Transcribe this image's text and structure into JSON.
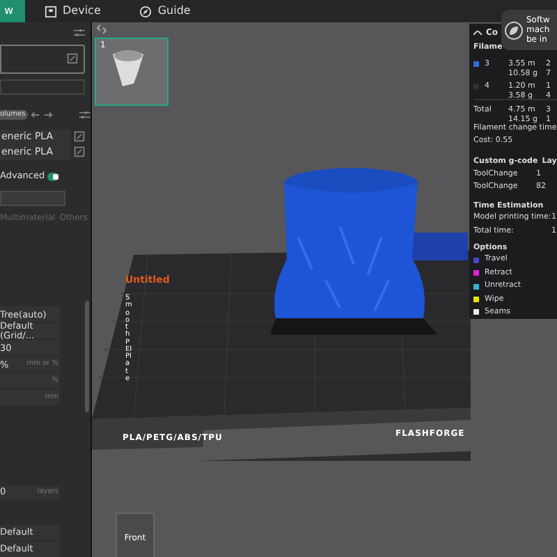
{
  "topbar": {
    "tabs": [
      {
        "label": "w",
        "selected": true
      },
      {
        "label": "Device",
        "selected": false
      },
      {
        "label": "Guide",
        "selected": false
      }
    ]
  },
  "left_panel": {
    "volumes_badge": "olumes",
    "filaments": [
      "eneric PLA",
      "eneric PLA"
    ],
    "advanced": {
      "label": "Advanced",
      "on": true
    },
    "tabs": [
      {
        "label": "Multimaterial",
        "selected": false
      },
      {
        "label": "Others",
        "selected": false
      }
    ],
    "fields": [
      {
        "value": "Tree(auto)"
      },
      {
        "value": "Default (Grid/..."
      },
      {
        "value": "30"
      },
      {
        "value": "%",
        "unit": "mm or %"
      },
      {
        "unit": "%"
      },
      {
        "unit": "mm"
      }
    ],
    "layers_field": {
      "value": "0",
      "unit": "layers"
    },
    "bottom_fields": [
      "Default",
      "Default"
    ]
  },
  "thumbnail": {
    "number": "1",
    "selected": true
  },
  "plate": {
    "name": "Untitled",
    "side_label": "Smooth PEI Plate",
    "materials": "PLA/PETG/ABS/TPU",
    "brand": "FLASHFORGE"
  },
  "view_cube": {
    "label": "Front"
  },
  "toast": {
    "lines": [
      "Softw",
      "mach",
      "be in"
    ]
  },
  "legend": {
    "title": "Co",
    "filament_header": "Filame",
    "filaments": [
      {
        "id": "3",
        "color": "#2b6fe0",
        "length": "3.55 m",
        "weight": "10.58 g",
        "column_3": [
          "2",
          "7"
        ]
      },
      {
        "id": "4",
        "color": "#303030",
        "length": "1.20 m",
        "weight": "3.58 g",
        "column_3": [
          "1",
          "4"
        ]
      }
    ],
    "total": {
      "label": "Total",
      "length": "4.75 m",
      "weight": "14.15 g",
      "column_3": [
        "3",
        "1"
      ]
    },
    "change_times": "Filament change time",
    "cost": "Cost:  0.55",
    "gcode_header": [
      "Custom g-code",
      "Lay"
    ],
    "gcode_rows": [
      [
        "ToolChange",
        "1"
      ],
      [
        "ToolChange",
        "82"
      ]
    ],
    "time_header": "Time Estimation",
    "times": [
      [
        "Model printing time:",
        "1"
      ],
      [
        "Total time:",
        "1"
      ]
    ],
    "options_header": "Options",
    "options": [
      {
        "label": "Travel",
        "color": "#4848c8"
      },
      {
        "label": "Retract",
        "color": "#e020e0"
      },
      {
        "label": "Unretract",
        "color": "#30b8d8"
      },
      {
        "label": "Wipe",
        "color": "#e8e800"
      },
      {
        "label": "Seams",
        "color": "#e8e8e8"
      }
    ]
  }
}
